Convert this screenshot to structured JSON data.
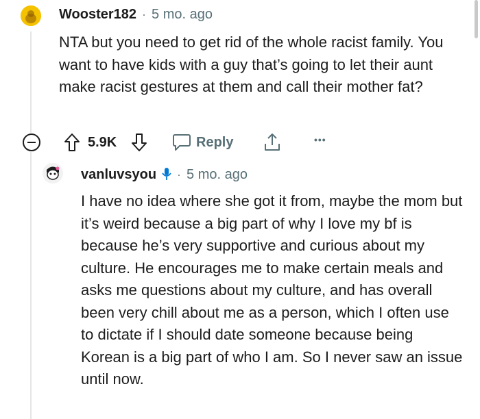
{
  "comment": {
    "username": "Wooster182",
    "separator": "·",
    "time": "5 mo. ago",
    "body": "NTA but you need to get rid of the whole racist family. You want to have kids with a guy that’s going to let their aunt make racist gestures at them and call their mother fat?",
    "avatar_color": "#f5c200"
  },
  "actions": {
    "collapse_icon": "minus-circle-icon",
    "upvote_icon": "arrow-up-icon",
    "score": "5.9K",
    "downvote_icon": "arrow-down-icon",
    "reply_icon": "chat-bubble-icon",
    "reply_label": "Reply",
    "share_icon": "share-icon",
    "more_icon": "more-dots-icon",
    "more_label": "•••"
  },
  "reply": {
    "username": "vanluvsyou",
    "badge_icon": "microphone-icon",
    "badge_color": "#0079d3",
    "separator": "·",
    "time": "5 mo. ago",
    "body": "I have no idea where she got it from, maybe the mom but it’s weird because a big part of why I love my bf is because he’s very supportive and curious about my culture. He encourages me to make certain meals and asks me questions about my culture, and has overall been very chill about me as a person, which I often use to dictate if I should date someone because being Korean is a big part of who I am. So I never saw an issue until now."
  }
}
